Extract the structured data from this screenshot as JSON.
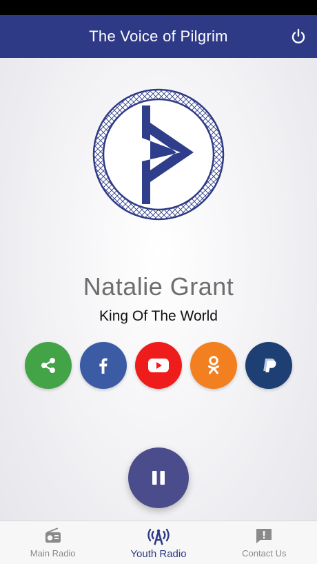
{
  "header": {
    "title": "The Voice of Pilgrim",
    "power_icon": "power-icon"
  },
  "now_playing": {
    "artist": "Natalie Grant",
    "song": "King Of The World"
  },
  "socials": [
    {
      "name": "share-icon",
      "color": "#43a447"
    },
    {
      "name": "facebook-icon",
      "color": "#3b5ba5"
    },
    {
      "name": "youtube-icon",
      "color": "#ee1c1b"
    },
    {
      "name": "odnoklassniki-icon",
      "color": "#f28020"
    },
    {
      "name": "paypal-icon",
      "color": "#1d3f73"
    }
  ],
  "player": {
    "state_icon": "pause-icon"
  },
  "tabs": [
    {
      "label": "Main Radio",
      "icon": "radio-icon",
      "active": false
    },
    {
      "label": "Youth Radio",
      "icon": "antenna-icon",
      "active": true
    },
    {
      "label": "Contact Us",
      "icon": "message-alert-icon",
      "active": false
    }
  ],
  "colors": {
    "header": "#2e3a86",
    "accent": "#2e3a86",
    "player": "#4a4c8c"
  }
}
